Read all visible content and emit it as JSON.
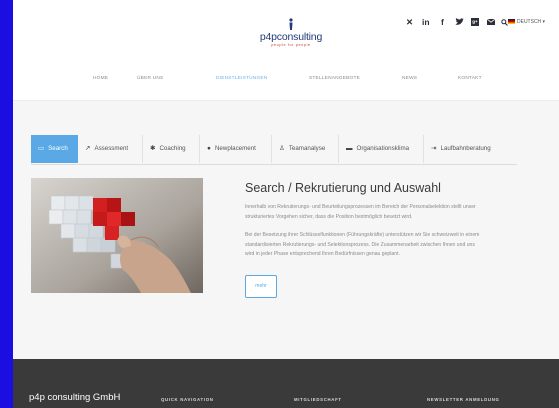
{
  "logo": {
    "name": "p4pconsulting",
    "tagline": "people for people"
  },
  "social_icons": [
    "xing-icon",
    "linkedin-icon",
    "facebook-icon",
    "twitter-icon",
    "google-plus-icon",
    "email-icon",
    "search-icon"
  ],
  "language": {
    "label": "DEUTSCH",
    "flag": "german-flag-icon"
  },
  "nav": {
    "items": [
      {
        "label": "HOME"
      },
      {
        "label": "ÜBER UNS"
      },
      {
        "label": "DIENSTLEISTUNGEN",
        "active": true
      },
      {
        "label": "STELLENANGEBOTE"
      },
      {
        "label": "NEWS"
      },
      {
        "label": "KONTAKT"
      }
    ]
  },
  "tabs": [
    {
      "label": "Search",
      "icon": "book-icon",
      "active": true
    },
    {
      "label": "Assessment",
      "icon": "chart-icon"
    },
    {
      "label": "Coaching",
      "icon": "gear-icon"
    },
    {
      "label": "Newplacement",
      "icon": "arrow-circle-icon"
    },
    {
      "label": "Teamanalyse",
      "icon": "person-icon"
    },
    {
      "label": "Organisationsklima",
      "icon": "car-icon"
    },
    {
      "label": "Laufbahnberatung",
      "icon": "sign-in-icon"
    }
  ],
  "content": {
    "title": "Search / Rekrutierung und Auswahl",
    "paragraph1_line1": "Innerhalb von Rekrutierungs- und Beurteilungsprozessen im Bereich der Personalselektion stellt unser",
    "paragraph1_line2": "strukturiertes Vorgehen sicher, dass die Position bestmöglich besetzt wird.",
    "paragraph2_line1": "Bei der Besetzung ihrer Schlüsselfunktionen (Führungskräfte) unterstützen wir Sie schweizweit in einem",
    "paragraph2_line2": "standardisierten Rekrutierungs- und Selektionsprozess. Die Zusammenarbeit zwischen Ihnen und uns",
    "paragraph2_line3": "wird in jeder Phase entsprechend Ihren Bedürfnissen genau geplant.",
    "more_label": "mehr"
  },
  "footer": {
    "brand": "p4p consulting GmbH",
    "col1": "QUICK NAVIGATION",
    "col2": "MITGLIEDSCHAFT",
    "col3": "NEWSLETTER ANMELDUNG"
  },
  "colors": {
    "accent": "#5aa9e6",
    "frame": "#1a0fe0",
    "footer": "#3a3a3a"
  }
}
